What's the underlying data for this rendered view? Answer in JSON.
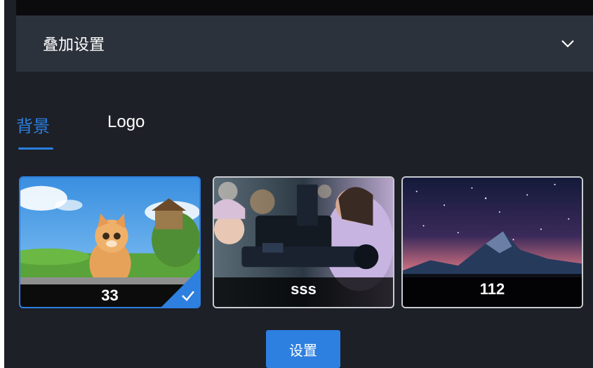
{
  "section": {
    "title": "叠加设置",
    "collapse_icon": "chevron-down-icon"
  },
  "tabs": [
    {
      "label": "背景",
      "active": true
    },
    {
      "label": "Logo",
      "active": false
    }
  ],
  "backgrounds": [
    {
      "name": "33",
      "selected": true
    },
    {
      "name": "sss",
      "selected": false
    },
    {
      "name": "112",
      "selected": false
    }
  ],
  "actions": {
    "set_label": "设置"
  },
  "colors": {
    "accent": "#2d7fe0",
    "panel": "#1d2027",
    "header": "#2c323b"
  }
}
